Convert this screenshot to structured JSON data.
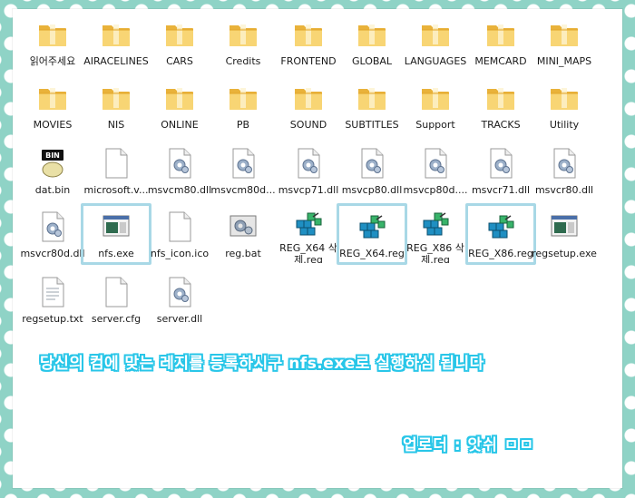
{
  "colors": {
    "background_teal": "#8fd3c6",
    "highlight_border": "#a8d8e6",
    "text_outline": "#28c6e8",
    "folder_yellow": "#f5c24d"
  },
  "files": [
    {
      "label": "읽어주세요",
      "icon": "folder-icon"
    },
    {
      "label": "AIRACELINES",
      "icon": "folder-icon"
    },
    {
      "label": "CARS",
      "icon": "folder-icon"
    },
    {
      "label": "Credits",
      "icon": "folder-icon"
    },
    {
      "label": "FRONTEND",
      "icon": "folder-icon"
    },
    {
      "label": "GLOBAL",
      "icon": "folder-icon"
    },
    {
      "label": "LANGUAGES",
      "icon": "folder-icon"
    },
    {
      "label": "MEMCARD",
      "icon": "folder-icon"
    },
    {
      "label": "MINI_MAPS",
      "icon": "folder-icon"
    },
    {
      "label": "MOVIES",
      "icon": "folder-icon"
    },
    {
      "label": "NIS",
      "icon": "folder-icon"
    },
    {
      "label": "ONLINE",
      "icon": "folder-icon"
    },
    {
      "label": "PB",
      "icon": "folder-icon"
    },
    {
      "label": "SOUND",
      "icon": "folder-icon"
    },
    {
      "label": "SUBTITLES",
      "icon": "folder-icon"
    },
    {
      "label": "Support",
      "icon": "folder-icon"
    },
    {
      "label": "TRACKS",
      "icon": "folder-icon"
    },
    {
      "label": "Utility",
      "icon": "folder-icon"
    },
    {
      "label": "dat.bin",
      "icon": "bin-file-icon",
      "badge": "BIN"
    },
    {
      "label": "microsoft.v...",
      "icon": "blank-file-icon"
    },
    {
      "label": "msvcm80.dll",
      "icon": "dll-file-icon"
    },
    {
      "label": "msvcm80d...",
      "icon": "dll-file-icon"
    },
    {
      "label": "msvcp71.dll",
      "icon": "dll-file-icon"
    },
    {
      "label": "msvcp80.dll",
      "icon": "dll-file-icon"
    },
    {
      "label": "msvcp80d....",
      "icon": "dll-file-icon"
    },
    {
      "label": "msvcr71.dll",
      "icon": "dll-file-icon"
    },
    {
      "label": "msvcr80.dll",
      "icon": "dll-file-icon"
    },
    {
      "label": "msvcr80d.dll",
      "icon": "dll-file-icon"
    },
    {
      "label": "nfs.exe",
      "icon": "exe-file-icon",
      "highlighted": true
    },
    {
      "label": "nfs_icon.ico",
      "icon": "blank-file-icon"
    },
    {
      "label": "reg.bat",
      "icon": "bat-file-icon"
    },
    {
      "label": "REG_X64 삭제.reg",
      "icon": "reg-file-icon"
    },
    {
      "label": "REG_X64.reg",
      "icon": "reg-file-icon",
      "highlighted": true
    },
    {
      "label": "REG_X86 삭제.reg",
      "icon": "reg-file-icon"
    },
    {
      "label": "REG_X86.reg",
      "icon": "reg-file-icon",
      "highlighted": true
    },
    {
      "label": "regsetup.exe",
      "icon": "exe-file-icon"
    },
    {
      "label": "regsetup.txt",
      "icon": "text-file-icon"
    },
    {
      "label": "server.cfg",
      "icon": "blank-file-icon"
    },
    {
      "label": "server.dll",
      "icon": "dll-file-icon"
    }
  ],
  "instruction_text": "당신의 컴에 맞는 레지를 등록하시구 nfs.exe로 실행하심 됩니다",
  "uploader_text": "업로더 : 앗쉬 ㅁㅁ"
}
